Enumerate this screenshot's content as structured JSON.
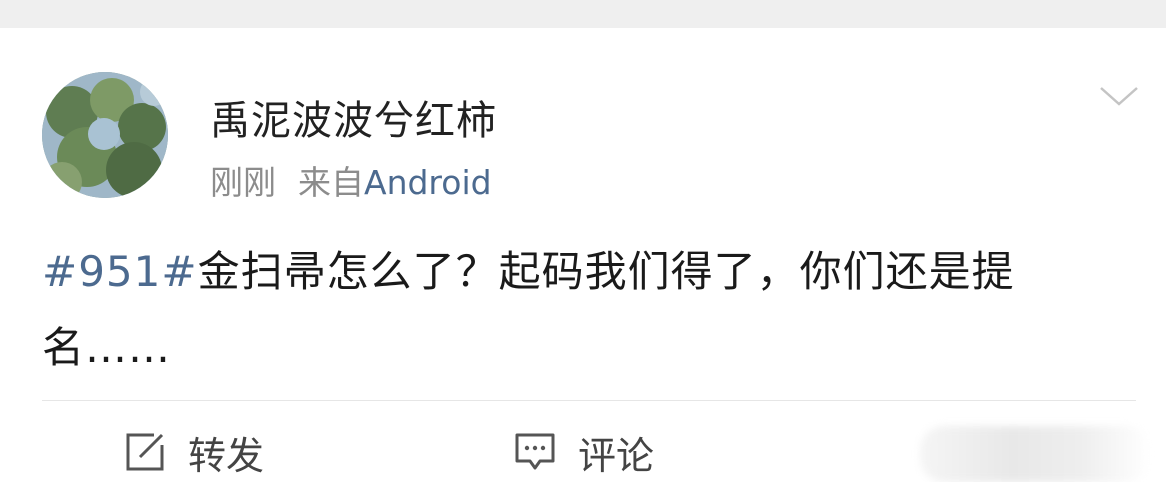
{
  "post": {
    "author": "禹泥波波兮红柿",
    "time": "刚刚",
    "source_prefix": "来自",
    "source_app": "Android",
    "hashtag": "#951#",
    "text": "金扫帚怎么了？起码我们得了，你们还是提名……"
  },
  "actions": {
    "repost_label": "转发",
    "comment_label": "评论"
  },
  "colors": {
    "link": "#4c6a8f",
    "text": "#1a1a1a",
    "meta": "#8c8c8c",
    "topbar": "#efefef"
  },
  "icons": {
    "more": "chevron-down-icon",
    "repost": "repost-icon",
    "comment": "comment-icon"
  }
}
